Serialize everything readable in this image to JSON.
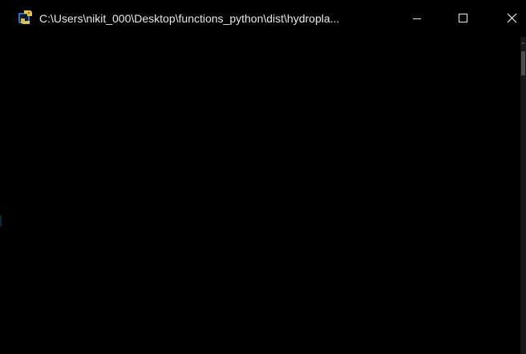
{
  "window": {
    "title": "C:\\Users\\nikit_000\\Desktop\\functions_python\\dist\\hydropla...",
    "icon": "python-icon",
    "controls": {
      "minimize_icon": "minimize-icon",
      "maximize_icon": "maximize-icon",
      "close_icon": "close-icon"
    }
  },
  "console": {
    "output": ""
  },
  "colors": {
    "background": "#000000",
    "title_text": "#e8e8e8",
    "scroll_track": "#171717",
    "scroll_thumb": "#4d4d4d"
  }
}
